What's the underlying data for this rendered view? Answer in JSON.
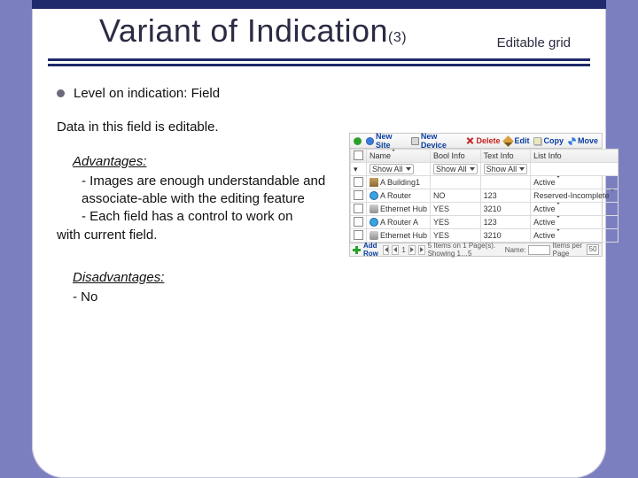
{
  "title_main": "Variant of Indication",
  "title_suffix": "(3)",
  "subtitle": "Editable grid",
  "bullet": "Level on indication: Field",
  "intro": "Data in this field is editable.",
  "adv_heading": "Advantages:",
  "adv_items": [
    "- Images are enough understandable and associate-able with the editing feature",
    "- Each field has a control to work on"
  ],
  "adv_tail": "with current field.",
  "dis_heading": "Disadvantages:",
  "dis_items": [
    "- No"
  ],
  "toolbar": {
    "new_site": "New Site",
    "new_device": "New Device",
    "delete": "Delete",
    "edit": "Edit",
    "copy": "Copy",
    "move": "Move"
  },
  "grid": {
    "headers": {
      "name": "Name",
      "bool": "Bool Info",
      "text": "Text Info",
      "list": "List Info"
    },
    "filter_label": "Show All",
    "rows": [
      {
        "icon": "build",
        "name": "A Building1",
        "bool": "",
        "text": "",
        "list": "Active"
      },
      {
        "icon": "router",
        "name": "A Router",
        "bool": "NO",
        "text": "123",
        "list": "Reserved-Incomplete"
      },
      {
        "icon": "hub",
        "name": "Ethernet Hub",
        "bool": "YES",
        "text": "3210",
        "list": "Active"
      },
      {
        "icon": "router",
        "name": "A Router A",
        "bool": "YES",
        "text": "123",
        "list": "Active"
      },
      {
        "icon": "hub",
        "name": "Ethernet Hub",
        "bool": "YES",
        "text": "3210",
        "list": "Active"
      }
    ],
    "add_row": "Add Row",
    "pager_text": "5 Items on 1 Page(s). Showing 1…5",
    "name_label": "Name:",
    "ipp_label": "Items per Page",
    "ipp_value": "50",
    "page_num": "1"
  }
}
